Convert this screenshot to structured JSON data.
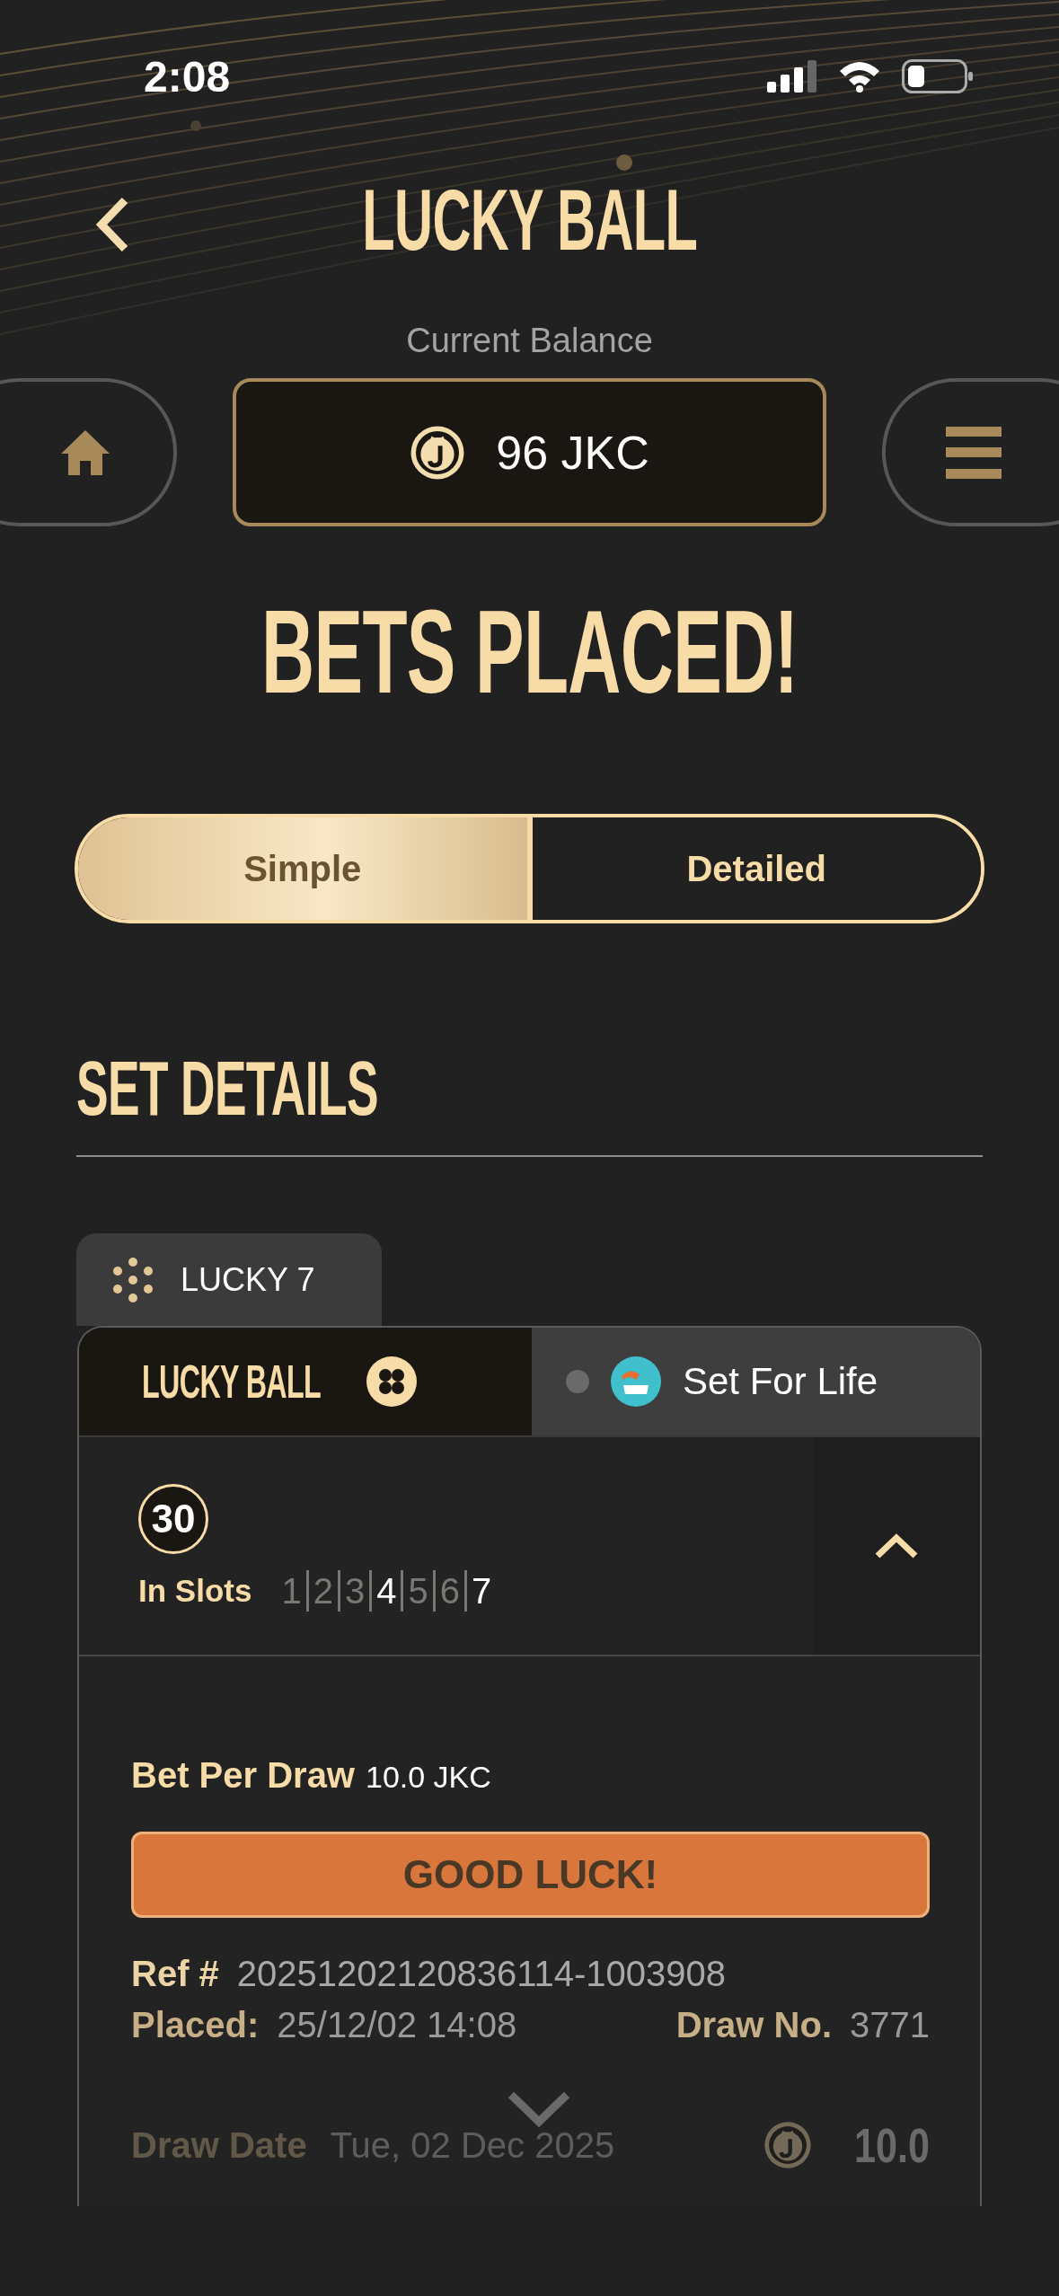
{
  "status_bar": {
    "time": "2:08"
  },
  "header": {
    "title": "LUCKY BALL"
  },
  "balance": {
    "label": "Current Balance",
    "amount": "96 JKC"
  },
  "headline": "BETS PLACED!",
  "view_toggle": [
    {
      "label": "Simple",
      "selected": true
    },
    {
      "label": "Detailed",
      "selected": false
    }
  ],
  "section_title": "SET DETAILS",
  "set_tab": {
    "label": "LUCKY 7"
  },
  "game_tabs": [
    {
      "label": "LUCKY BALL",
      "selected": true
    },
    {
      "label": "Set For Life",
      "selected": false
    }
  ],
  "bet": {
    "ball": "30",
    "slots_label": "In Slots",
    "expanded": true,
    "slots": [
      {
        "number": "1",
        "selected": false
      },
      {
        "number": "2",
        "selected": false
      },
      {
        "number": "3",
        "selected": false
      },
      {
        "number": "4",
        "selected": true
      },
      {
        "number": "5",
        "selected": false
      },
      {
        "number": "6",
        "selected": false
      },
      {
        "number": "7",
        "selected": true
      }
    ],
    "bet_per_draw_label": "Bet Per Draw",
    "bet_per_draw": "10.0 JKC",
    "button": "GOOD LUCK!",
    "ref_label": "Ref #",
    "ref": "20251202120836114-1003908",
    "placed_label": "Placed:",
    "placed": "25/12/02 14:08",
    "draw_no_label": "Draw No.",
    "draw_no": "3771",
    "draw_date_label": "Draw Date",
    "draw_date": "Tue, 02 Dec 2025",
    "amount": "10.0"
  }
}
